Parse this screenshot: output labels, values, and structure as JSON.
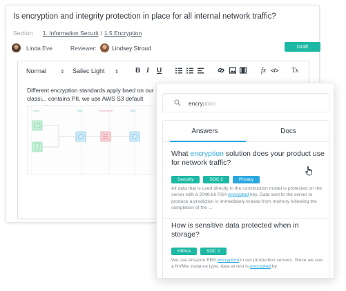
{
  "question": {
    "title": "Is encryption and integrity protection in place for all internal network traffic?",
    "section_label": "Section",
    "breadcrumb_1": "1. Information Securit",
    "breadcrumb_sep": "/",
    "breadcrumb_2": "1.5 Encryption"
  },
  "people": {
    "owner_name": "Linda Eve",
    "reviewer_label": "Reviewer:",
    "reviewer_name": "Lindsey Stroud",
    "status_badge": "Draft"
  },
  "toolbar": {
    "paragraph_style": "Normal",
    "font": "Sailec Light",
    "bold": "B",
    "italic": "I",
    "underline": "U",
    "formula": "fx",
    "code": "</>",
    "clear_format": "Tx"
  },
  "editor": {
    "text": "Different encryption standards apply baed on our classi... contains PII, we use AWS S3 default encryption."
  },
  "diagram": {
    "labels": [
      "Client",
      "VBS",
      "Prune server",
      "VBS"
    ]
  },
  "search": {
    "typed": "encry",
    "ghost": "ption"
  },
  "tabs": {
    "answers": "Answers",
    "docs": "Docs"
  },
  "results": [
    {
      "title_pre": "What ",
      "title_hl": "encryption",
      "title_post": " solution does your product use for network traffic?",
      "tags": [
        "Security",
        "SOC 2",
        "Privacy"
      ],
      "snippet_pre": "All data that is used directly in the construction model is protected on the server with a 2048-bit RSA ",
      "snippet_hl": "encrypted",
      "snippet_post": " key. Data sent to the server to produce a prediction is immediately erased from memory following the completion of the ..."
    },
    {
      "title": "How is sensitive data protected when in storage?",
      "tags": [
        "HIPAA",
        "SOC 2"
      ],
      "snippet_pre": "We use Amazon EBS ",
      "snippet_hl": "encryption",
      "snippet_mid": " in our production servers. Since we use a NVMw instance type, data at rest is ",
      "snippet_hl2": "encrypted",
      "snippet_post": " by"
    }
  ],
  "colors": {
    "accent_teal": "#1db8a3",
    "accent_blue": "#2ba7e0"
  }
}
